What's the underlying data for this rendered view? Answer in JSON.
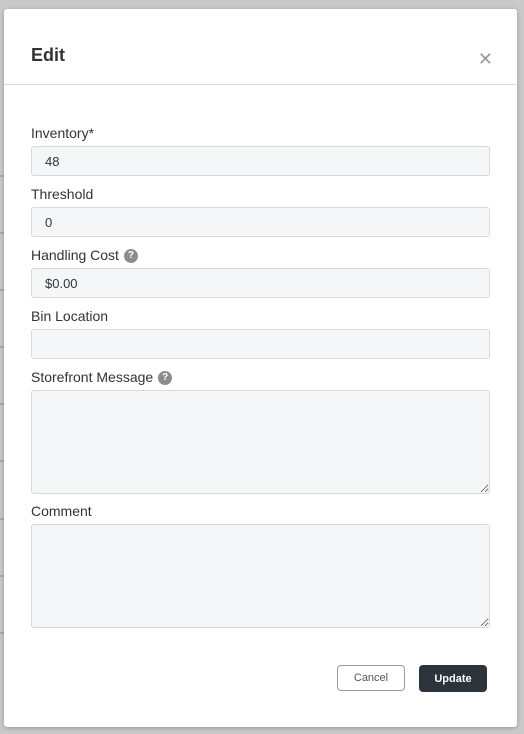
{
  "modal": {
    "title": "Edit",
    "close_icon": "close-icon"
  },
  "fields": {
    "inventory": {
      "label": "Inventory*",
      "value": "48"
    },
    "threshold": {
      "label": "Threshold",
      "value": "0"
    },
    "handling_cost": {
      "label": "Handling Cost",
      "value": "$0.00",
      "help_icon": "?"
    },
    "bin_location": {
      "label": "Bin Location",
      "value": ""
    },
    "storefront_message": {
      "label": "Storefront Message",
      "value": "",
      "help_icon": "?"
    },
    "comment": {
      "label": "Comment",
      "value": ""
    }
  },
  "buttons": {
    "cancel": "Cancel",
    "update": "Update"
  },
  "colors": {
    "primary_button": "#2e343b",
    "input_background": "#f5f6f8",
    "input_border": "#d7d9dd"
  }
}
